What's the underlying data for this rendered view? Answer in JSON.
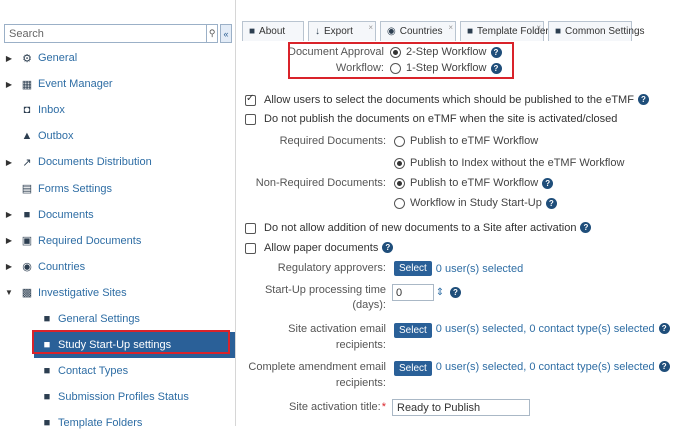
{
  "sidebar": {
    "search_placeholder": "Search",
    "items": [
      {
        "label": "General",
        "icon": "gears-icon",
        "caret": true,
        "level": 0
      },
      {
        "label": "Event Manager",
        "icon": "calendar-icon",
        "caret": true,
        "level": 0
      },
      {
        "label": "Inbox",
        "icon": "inbox-icon",
        "caret": false,
        "level": 0
      },
      {
        "label": "Outbox",
        "icon": "outbox-icon",
        "caret": false,
        "level": 0
      },
      {
        "label": "Documents Distribution",
        "icon": "share-icon",
        "caret": true,
        "level": 0
      },
      {
        "label": "Forms Settings",
        "icon": "form-icon",
        "caret": false,
        "level": 0
      },
      {
        "label": "Documents",
        "icon": "document-icon",
        "caret": true,
        "level": 0
      },
      {
        "label": "Required Documents",
        "icon": "clipboard-icon",
        "caret": true,
        "level": 0
      },
      {
        "label": "Countries",
        "icon": "globe-icon",
        "caret": true,
        "level": 0
      },
      {
        "label": "Investigative Sites",
        "icon": "sitemap-icon",
        "caret": "open",
        "level": 0
      },
      {
        "label": "General Settings",
        "icon": "document-icon",
        "caret": false,
        "level": 1
      },
      {
        "label": "Study Start-Up settings",
        "icon": "document-icon",
        "caret": false,
        "level": 1,
        "selected": true
      },
      {
        "label": "Contact Types",
        "icon": "document-icon",
        "caret": false,
        "level": 1
      },
      {
        "label": "Submission Profiles Status",
        "icon": "document-icon",
        "caret": false,
        "level": 1
      },
      {
        "label": "Template Folders",
        "icon": "document-icon",
        "caret": false,
        "level": 1
      }
    ]
  },
  "tabs": [
    {
      "label": "About",
      "icon": "document-icon",
      "close": false
    },
    {
      "label": "Export",
      "icon": "download-icon",
      "close": true
    },
    {
      "label": "Countries",
      "icon": "globe-icon",
      "close": true
    },
    {
      "label": "Template Folders",
      "icon": "document-icon",
      "close": true
    },
    {
      "label": "Common Settings",
      "icon": "document-icon",
      "close": false
    }
  ],
  "form": {
    "approval_label_1": "Document Approval",
    "approval_label_2": "Workflow:",
    "approval_opt1": "2-Step Workflow",
    "approval_opt2": "1-Step Workflow",
    "allow_select_etmf": "Allow users to select the documents which should be published to the eTMF",
    "no_publish_closed": "Do not publish the documents on eTMF when the site is activated/closed",
    "required_docs_label": "Required Documents:",
    "req_opt1": "Publish to eTMF Workflow",
    "req_opt2": "Publish to Index without the eTMF Workflow",
    "nonreq_docs_label": "Non-Required Documents:",
    "nonreq_opt1": "Publish to eTMF Workflow",
    "nonreq_opt2": "Workflow in Study Start-Up",
    "no_addition_after_activation": "Do not allow addition of new documents to a Site after activation",
    "allow_paper": "Allow paper documents",
    "regulatory_label": "Regulatory approvers:",
    "select_label": "Select",
    "regulatory_value": "0 user(s) selected",
    "startup_time_label_1": "Start-Up processing time",
    "startup_time_label_2": "(days):",
    "startup_time_value": "0",
    "site_act_email_label_1": "Site activation email",
    "site_act_email_label_2": "recipients:",
    "site_act_email_value": "0 user(s) selected, 0 contact type(s) selected",
    "amend_email_label_1": "Complete amendment email",
    "amend_email_label_2": "recipients:",
    "amend_email_value": "0 user(s) selected, 0 contact type(s) selected",
    "site_act_title_label": "Site activation title:",
    "required_mark": "*",
    "site_act_title_value": "Ready to Publish"
  }
}
